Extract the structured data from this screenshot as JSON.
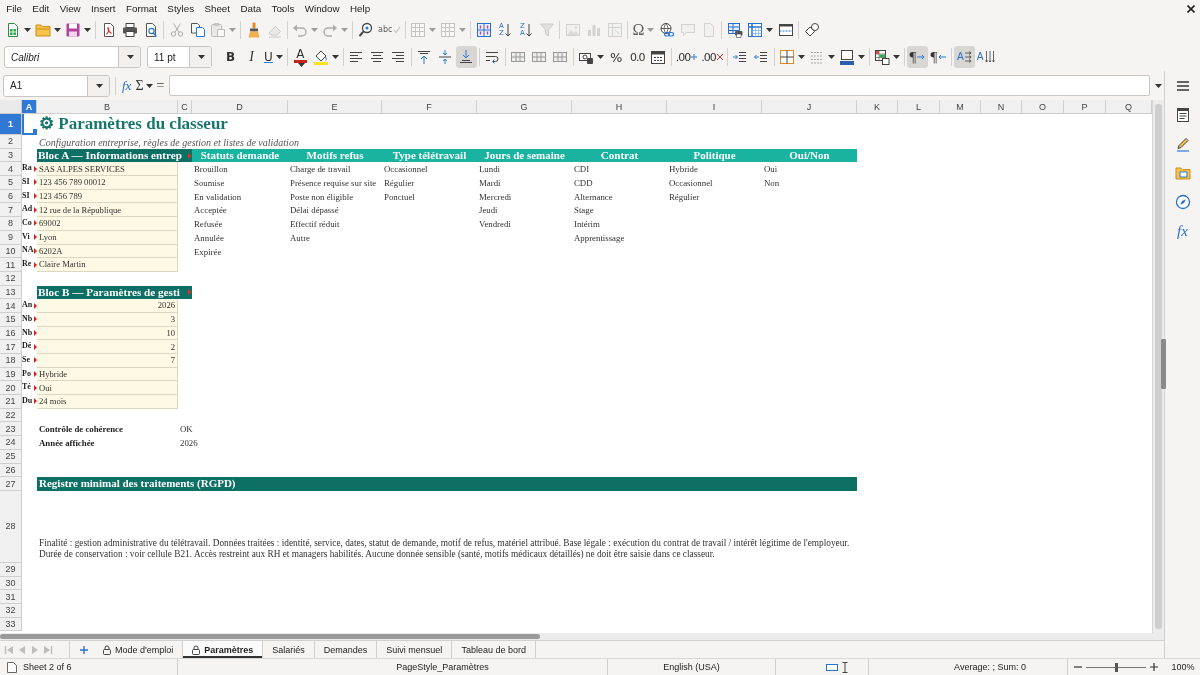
{
  "menu_bar": [
    "File",
    "Edit",
    "View",
    "Insert",
    "Format",
    "Styles",
    "Sheet",
    "Data",
    "Tools",
    "Window",
    "Help"
  ],
  "standard_toolbar": [
    [
      {
        "kind": "new",
        "disabled": false
      },
      {
        "kind": "open",
        "disabled": false
      },
      {
        "kind": "save",
        "disabled": false
      }
    ],
    [
      {
        "kind": "pdf",
        "disabled": false
      },
      {
        "kind": "print",
        "disabled": false
      },
      {
        "kind": "preview",
        "disabled": false
      }
    ],
    [
      {
        "kind": "cut",
        "disabled": true
      },
      {
        "kind": "copy",
        "disabled": false
      },
      {
        "kind": "paste",
        "disabled": true
      }
    ],
    [
      {
        "kind": "clone",
        "disabled": false
      },
      {
        "kind": "clear",
        "disabled": true
      }
    ],
    [
      {
        "kind": "undo",
        "disabled": true
      },
      {
        "kind": "redo",
        "disabled": true
      }
    ],
    [
      {
        "kind": "find",
        "disabled": false
      },
      {
        "kind": "spelling",
        "label": "abc",
        "disabled": true
      }
    ],
    [
      {
        "kind": "row",
        "disabled": true
      },
      {
        "kind": "column",
        "disabled": true
      }
    ],
    [
      {
        "kind": "sort",
        "disabled": false
      },
      {
        "kind": "ascending",
        "label": "AZ",
        "disabled": false
      },
      {
        "kind": "descending",
        "label": "ZA",
        "disabled": false
      },
      {
        "kind": "autofilter",
        "disabled": true
      }
    ],
    [
      {
        "kind": "image",
        "disabled": true
      },
      {
        "kind": "chart",
        "disabled": true
      },
      {
        "kind": "pivot",
        "disabled": true
      }
    ],
    [
      {
        "kind": "special",
        "label": "Ω",
        "disabled": true
      },
      {
        "kind": "hyperlink",
        "disabled": false
      },
      {
        "kind": "comment",
        "disabled": true
      },
      {
        "kind": "page",
        "disabled": true
      }
    ],
    [
      {
        "kind": "printarea",
        "disabled": false
      },
      {
        "kind": "freeze",
        "disabled": false
      },
      {
        "kind": "split",
        "disabled": false
      }
    ],
    [
      {
        "kind": "shapes",
        "disabled": false
      }
    ]
  ],
  "formatting_toolbar": {
    "font_name": "Calibri",
    "font_size": "11 pt",
    "groups": [
      [
        {
          "kind": "bold",
          "label": "B",
          "on": false
        },
        {
          "kind": "italic",
          "label": "I",
          "on": false
        },
        {
          "kind": "underline",
          "label": "U",
          "on": false
        }
      ],
      [
        {
          "kind": "fontcolor",
          "label": "A",
          "on": false
        },
        {
          "kind": "highlight",
          "on": false
        }
      ],
      [
        {
          "kind": "left",
          "on": false
        },
        {
          "kind": "center",
          "on": false
        },
        {
          "kind": "right",
          "on": false
        }
      ],
      [
        {
          "kind": "top",
          "on": false
        },
        {
          "kind": "middle",
          "on": false
        },
        {
          "kind": "bottom",
          "on": true
        }
      ],
      [
        {
          "kind": "wrap",
          "on": false
        }
      ],
      [
        {
          "kind": "mergecenter",
          "on": false
        },
        {
          "kind": "merge",
          "on": false
        },
        {
          "kind": "unmerge",
          "on": false
        }
      ],
      [
        {
          "kind": "numberformat",
          "on": false
        },
        {
          "kind": "percent",
          "label": "%",
          "on": false
        },
        {
          "kind": "decimal",
          "label": "0.0",
          "on": false
        },
        {
          "kind": "date",
          "on": false
        }
      ],
      [
        {
          "kind": "adddecimal",
          "label": ".00",
          "on": false
        },
        {
          "kind": "deldecimal",
          "label": ".00",
          "on": false
        }
      ],
      [
        {
          "kind": "indent",
          "on": false
        },
        {
          "kind": "outdent",
          "on": false
        }
      ],
      [
        {
          "kind": "borders",
          "on": false
        },
        {
          "kind": "borderstyle",
          "on": false
        },
        {
          "kind": "bordercolor",
          "on": false
        }
      ],
      [
        {
          "kind": "conditional",
          "on": false
        }
      ],
      [
        {
          "kind": "ltr",
          "label": "¶",
          "on": true
        },
        {
          "kind": "rtl",
          "label": "¶",
          "on": false
        }
      ],
      [
        {
          "kind": "horizontal",
          "label": "A",
          "on": true
        },
        {
          "kind": "vertical",
          "label": "A",
          "on": false
        }
      ]
    ]
  },
  "formula_bar": {
    "cell_reference": "A1",
    "function_wizard": "fx",
    "sum": "Σ",
    "equals": "="
  },
  "sheet": {
    "columns": [
      {
        "label": "A",
        "selected": true
      },
      {
        "label": "B",
        "selected": false
      },
      {
        "label": "C",
        "selected": false
      },
      {
        "label": "D",
        "selected": false
      },
      {
        "label": "E",
        "selected": false
      },
      {
        "label": "F",
        "selected": false
      },
      {
        "label": "G",
        "selected": false
      },
      {
        "label": "H",
        "selected": false
      },
      {
        "label": "I",
        "selected": false
      },
      {
        "label": "J",
        "selected": false
      },
      {
        "label": "K",
        "selected": false
      },
      {
        "label": "L",
        "selected": false
      },
      {
        "label": "M",
        "selected": false
      },
      {
        "label": "N",
        "selected": false
      },
      {
        "label": "O",
        "selected": false
      },
      {
        "label": "P",
        "selected": false
      },
      {
        "label": "Q",
        "selected": false
      }
    ],
    "rows": [
      {
        "label": "1",
        "selected": true
      },
      {
        "label": "2",
        "selected": false
      },
      {
        "label": "3",
        "selected": false
      },
      {
        "label": "4",
        "selected": false
      },
      {
        "label": "5",
        "selected": false
      },
      {
        "label": "6",
        "selected": false
      },
      {
        "label": "7",
        "selected": false
      },
      {
        "label": "8",
        "selected": false
      },
      {
        "label": "9",
        "selected": false
      },
      {
        "label": "10",
        "selected": false
      },
      {
        "label": "11",
        "selected": false
      },
      {
        "label": "12",
        "selected": false
      },
      {
        "label": "13",
        "selected": false
      },
      {
        "label": "14",
        "selected": false
      },
      {
        "label": "15",
        "selected": false
      },
      {
        "label": "16",
        "selected": false
      },
      {
        "label": "17",
        "selected": false
      },
      {
        "label": "18",
        "selected": false
      },
      {
        "label": "19",
        "selected": false
      },
      {
        "label": "20",
        "selected": false
      },
      {
        "label": "21",
        "selected": false
      },
      {
        "label": "22",
        "selected": false
      },
      {
        "label": "23",
        "selected": false
      },
      {
        "label": "24",
        "selected": false
      },
      {
        "label": "25",
        "selected": false
      },
      {
        "label": "26",
        "selected": false
      },
      {
        "label": "27",
        "selected": false
      },
      {
        "label": "28",
        "selected": false
      },
      {
        "label": "29",
        "selected": false
      },
      {
        "label": "30",
        "selected": false
      },
      {
        "label": "31",
        "selected": false
      },
      {
        "label": "32",
        "selected": false
      },
      {
        "label": "33",
        "selected": false
      }
    ],
    "title": "⚙ Paramètres du classeur",
    "subtitle": "Configuration entreprise, règles de gestion et listes de validation",
    "bloc_a": {
      "title": "Bloc A — Informations entrep",
      "overflow": true,
      "fields": [
        {
          "label": "Ra",
          "overflow": true,
          "value": "SAS ALPES SERVICES",
          "kind": "text"
        },
        {
          "label": "SI",
          "overflow": true,
          "value": "123 456 789 00012",
          "kind": "text"
        },
        {
          "label": "SI",
          "overflow": true,
          "value": "123 456 789",
          "kind": "text"
        },
        {
          "label": "Ad",
          "overflow": true,
          "value": "12 rue de la République",
          "kind": "text"
        },
        {
          "label": "Co",
          "overflow": true,
          "value": "69002",
          "kind": "text"
        },
        {
          "label": "Vi",
          "overflow": true,
          "value": "Lyon",
          "kind": "text"
        },
        {
          "label": "NA",
          "overflow": true,
          "value": "6202A",
          "kind": "text"
        },
        {
          "label": "Re",
          "overflow": true,
          "value": "Claire Martin",
          "kind": "text"
        }
      ]
    },
    "lists": [
      {
        "header": "Statuts demande",
        "items": [
          "Brouillon",
          "Soumise",
          "En validation",
          "Acceptée",
          "Refusée",
          "Annulée",
          "Expirée"
        ]
      },
      {
        "header": "Motifs refus",
        "items": [
          "Charge de travail",
          "Présence requise sur site",
          "Poste non éligible",
          "Délai dépassé",
          "Effectif réduit",
          "Autre"
        ]
      },
      {
        "header": "Type télétravail",
        "items": [
          "Occasionnel",
          "Régulier",
          "Ponctuel"
        ]
      },
      {
        "header": "Jours de semaine",
        "items": [
          "Lundi",
          "Mardi",
          "Mercredi",
          "Jeudi",
          "Vendredi"
        ]
      },
      {
        "header": "Contrat",
        "items": [
          "CDI",
          "CDD",
          "Alternance",
          "Stage",
          "Intérim",
          "Apprentissage"
        ]
      },
      {
        "header": "Politique",
        "items": [
          "Hybride",
          "Occasionnel",
          "Régulier"
        ]
      },
      {
        "header": "Oui/Non",
        "items": [
          "Oui",
          "Non"
        ]
      }
    ],
    "bloc_b": {
      "title": "Bloc B — Paramètres de gesti",
      "overflow": true,
      "fields": [
        {
          "label": "An",
          "overflow": true,
          "value": "2026",
          "kind": "number"
        },
        {
          "label": "Nb",
          "overflow": true,
          "value": "3",
          "kind": "number"
        },
        {
          "label": "Nb",
          "overflow": true,
          "value": "10",
          "kind": "number"
        },
        {
          "label": "Dé",
          "overflow": true,
          "value": "2",
          "kind": "number"
        },
        {
          "label": "Se",
          "overflow": true,
          "value": "7",
          "kind": "number"
        },
        {
          "label": "Po",
          "overflow": true,
          "value": "Hybride",
          "kind": "text"
        },
        {
          "label": "Té",
          "overflow": true,
          "value": "Oui",
          "kind": "text"
        },
        {
          "label": "Du",
          "overflow": true,
          "value": "24 mois",
          "kind": "text"
        }
      ]
    },
    "checks": [
      {
        "label": "Contrôle de cohérence",
        "value": "OK"
      },
      {
        "label": "Année affichée",
        "value": "2026"
      }
    ],
    "register": {
      "title": "Registre minimal des traitements (RGPD)",
      "text": "Finalité : gestion administrative du télétravail. Données traitées : identité, service, dates, statut de demande, motif de refus, matériel attribué. Base légale : exécution du contrat de travail / intérêt légitime de l'employeur. Durée de conservation : voir cellule B21. Accès restreint aux RH et managers habilités. Aucune donnée sensible (santé, motifs médicaux détaillés) ne doit être saisie dans ce classeur."
    }
  },
  "sidebar": [
    {
      "kind": "menu"
    },
    {
      "kind": "properties"
    },
    {
      "kind": "styles"
    },
    {
      "kind": "gallery"
    },
    {
      "kind": "navigator"
    },
    {
      "kind": "functions",
      "label": "fx"
    }
  ],
  "sheet_tabs": {
    "nav": [
      {
        "kind": "first",
        "disabled": true
      },
      {
        "kind": "previous",
        "disabled": true
      },
      {
        "kind": "next",
        "disabled": true
      },
      {
        "kind": "last",
        "disabled": true
      }
    ],
    "tabs": [
      {
        "label": "Mode d'emploi",
        "selected": false,
        "protected": true
      },
      {
        "label": "Paramètres",
        "selected": true,
        "protected": true
      },
      {
        "label": "Salariés",
        "selected": false,
        "protected": false
      },
      {
        "label": "Demandes",
        "selected": false,
        "protected": false
      },
      {
        "label": "Suivi mensuel",
        "selected": false,
        "protected": false
      },
      {
        "label": "Tableau de bord",
        "selected": false,
        "protected": false
      }
    ]
  },
  "status_bar": {
    "sheet_position": "Sheet 2 of 6",
    "page_style": "PageStyle_Paramètres",
    "language": "English (USA)",
    "selection_summary": "Average: ; Sum: 0",
    "zoom": {
      "level": 0.5,
      "reading": "100%"
    }
  }
}
